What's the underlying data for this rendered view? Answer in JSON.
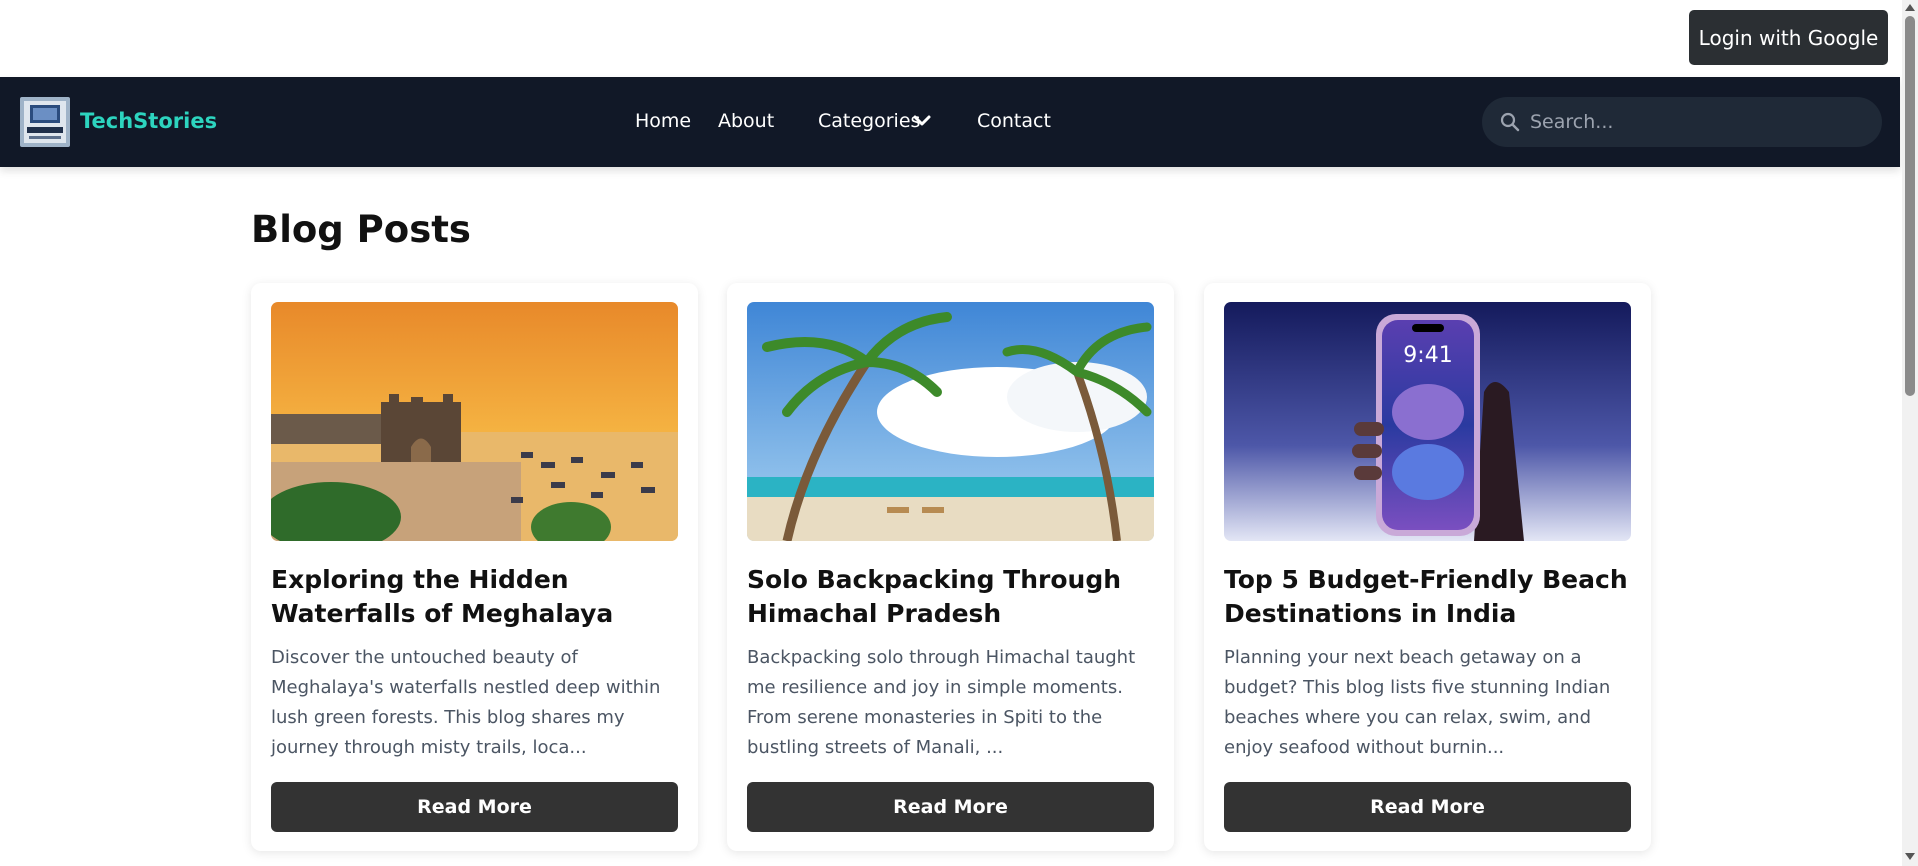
{
  "topbar": {
    "login_label": "Login with Google"
  },
  "navbar": {
    "brand": "TechStories",
    "links": [
      {
        "label": "Home"
      },
      {
        "label": "About"
      },
      {
        "label": "Categories"
      },
      {
        "label": "Contact"
      }
    ],
    "search_placeholder": "Search...",
    "colors": {
      "bg": "#111827",
      "brand": "#2dd4bf",
      "search_bg": "#1f2937"
    }
  },
  "main": {
    "title": "Blog Posts",
    "posts": [
      {
        "title": "Exploring the Hidden Waterfalls of Meghalaya",
        "excerpt": "Discover the untouched beauty of Meghalaya's waterfalls nestled deep within lush green forests. This blog shares my journey through misty trails, loca...",
        "button": "Read More",
        "image": "gateway-of-india-sunset-image"
      },
      {
        "title": "Solo Backpacking Through Himachal Pradesh",
        "excerpt": "Backpacking solo through Himachal taught me resilience and joy in simple moments. From serene monasteries in Spiti to the bustling streets of Manali, ...",
        "button": "Read More",
        "image": "palm-beach-image"
      },
      {
        "title": "Top 5 Budget-Friendly Beach Destinations in India",
        "excerpt": "Planning your next beach getaway on a budget? This blog lists five stunning Indian beaches where you can relax, swim, and enjoy seafood without burnin...",
        "button": "Read More",
        "image": "smartphone-in-hand-image",
        "phone_time": "9:41"
      }
    ]
  }
}
